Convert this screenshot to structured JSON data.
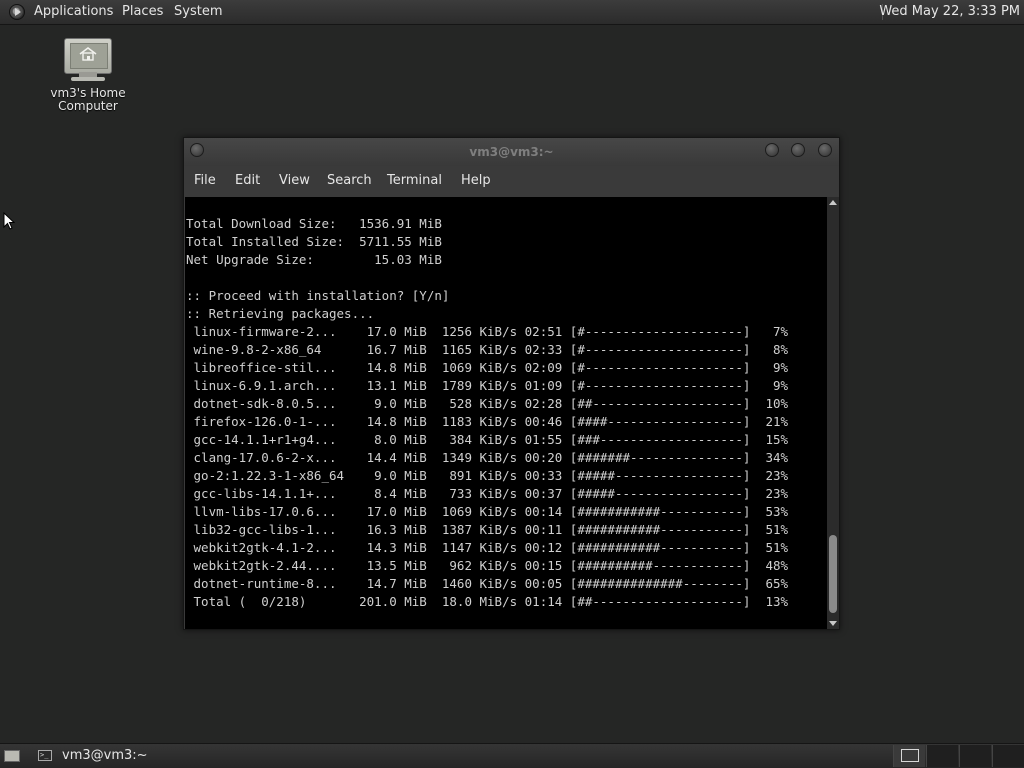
{
  "top_panel": {
    "menus": [
      "Applications",
      "Places",
      "System"
    ],
    "clock": "Wed May 22,  3:33 PM"
  },
  "desktop": {
    "icon_label_line1": "vm3's Home",
    "icon_label_line2": "Computer"
  },
  "terminal": {
    "title": "vm3@vm3:~",
    "menu": [
      "File",
      "Edit",
      "View",
      "Search",
      "Terminal",
      "Help"
    ],
    "lines": [
      "Total Download Size:   1536.91 MiB",
      "Total Installed Size:  5711.55 MiB",
      "Net Upgrade Size:        15.03 MiB",
      "",
      ":: Proceed with installation? [Y/n]",
      ":: Retrieving packages...",
      " linux-firmware-2...    17.0 MiB  1256 KiB/s 02:51 [#---------------------]   7%",
      " wine-9.8-2-x86_64      16.7 MiB  1165 KiB/s 02:33 [#---------------------]   8%",
      " libreoffice-stil...    14.8 MiB  1069 KiB/s 02:09 [#---------------------]   9%",
      " linux-6.9.1.arch...    13.1 MiB  1789 KiB/s 01:09 [#---------------------]   9%",
      " dotnet-sdk-8.0.5...     9.0 MiB   528 KiB/s 02:28 [##--------------------]  10%",
      " firefox-126.0-1-...    14.8 MiB  1183 KiB/s 00:46 [####------------------]  21%",
      " gcc-14.1.1+r1+g4...     8.0 MiB   384 KiB/s 01:55 [###-------------------]  15%",
      " clang-17.0.6-2-x...    14.4 MiB  1349 KiB/s 00:20 [#######---------------]  34%",
      " go-2:1.22.3-1-x86_64    9.0 MiB   891 KiB/s 00:33 [#####-----------------]  23%",
      " gcc-libs-14.1.1+...     8.4 MiB   733 KiB/s 00:37 [#####-----------------]  23%",
      " llvm-libs-17.0.6...    17.0 MiB  1069 KiB/s 00:14 [###########-----------]  53%",
      " lib32-gcc-libs-1...    16.3 MiB  1387 KiB/s 00:11 [###########-----------]  51%",
      " webkit2gtk-4.1-2...    14.3 MiB  1147 KiB/s 00:12 [###########-----------]  51%",
      " webkit2gtk-2.44....    13.5 MiB   962 KiB/s 00:15 [##########------------]  48%",
      " dotnet-runtime-8...    14.7 MiB  1460 KiB/s 00:05 [##############--------]  65%",
      " Total (  0/218)       201.0 MiB  18.0 MiB/s 01:14 [##--------------------]  13%"
    ]
  },
  "bottom_panel": {
    "taskbar_label": "vm3@vm3:~"
  }
}
